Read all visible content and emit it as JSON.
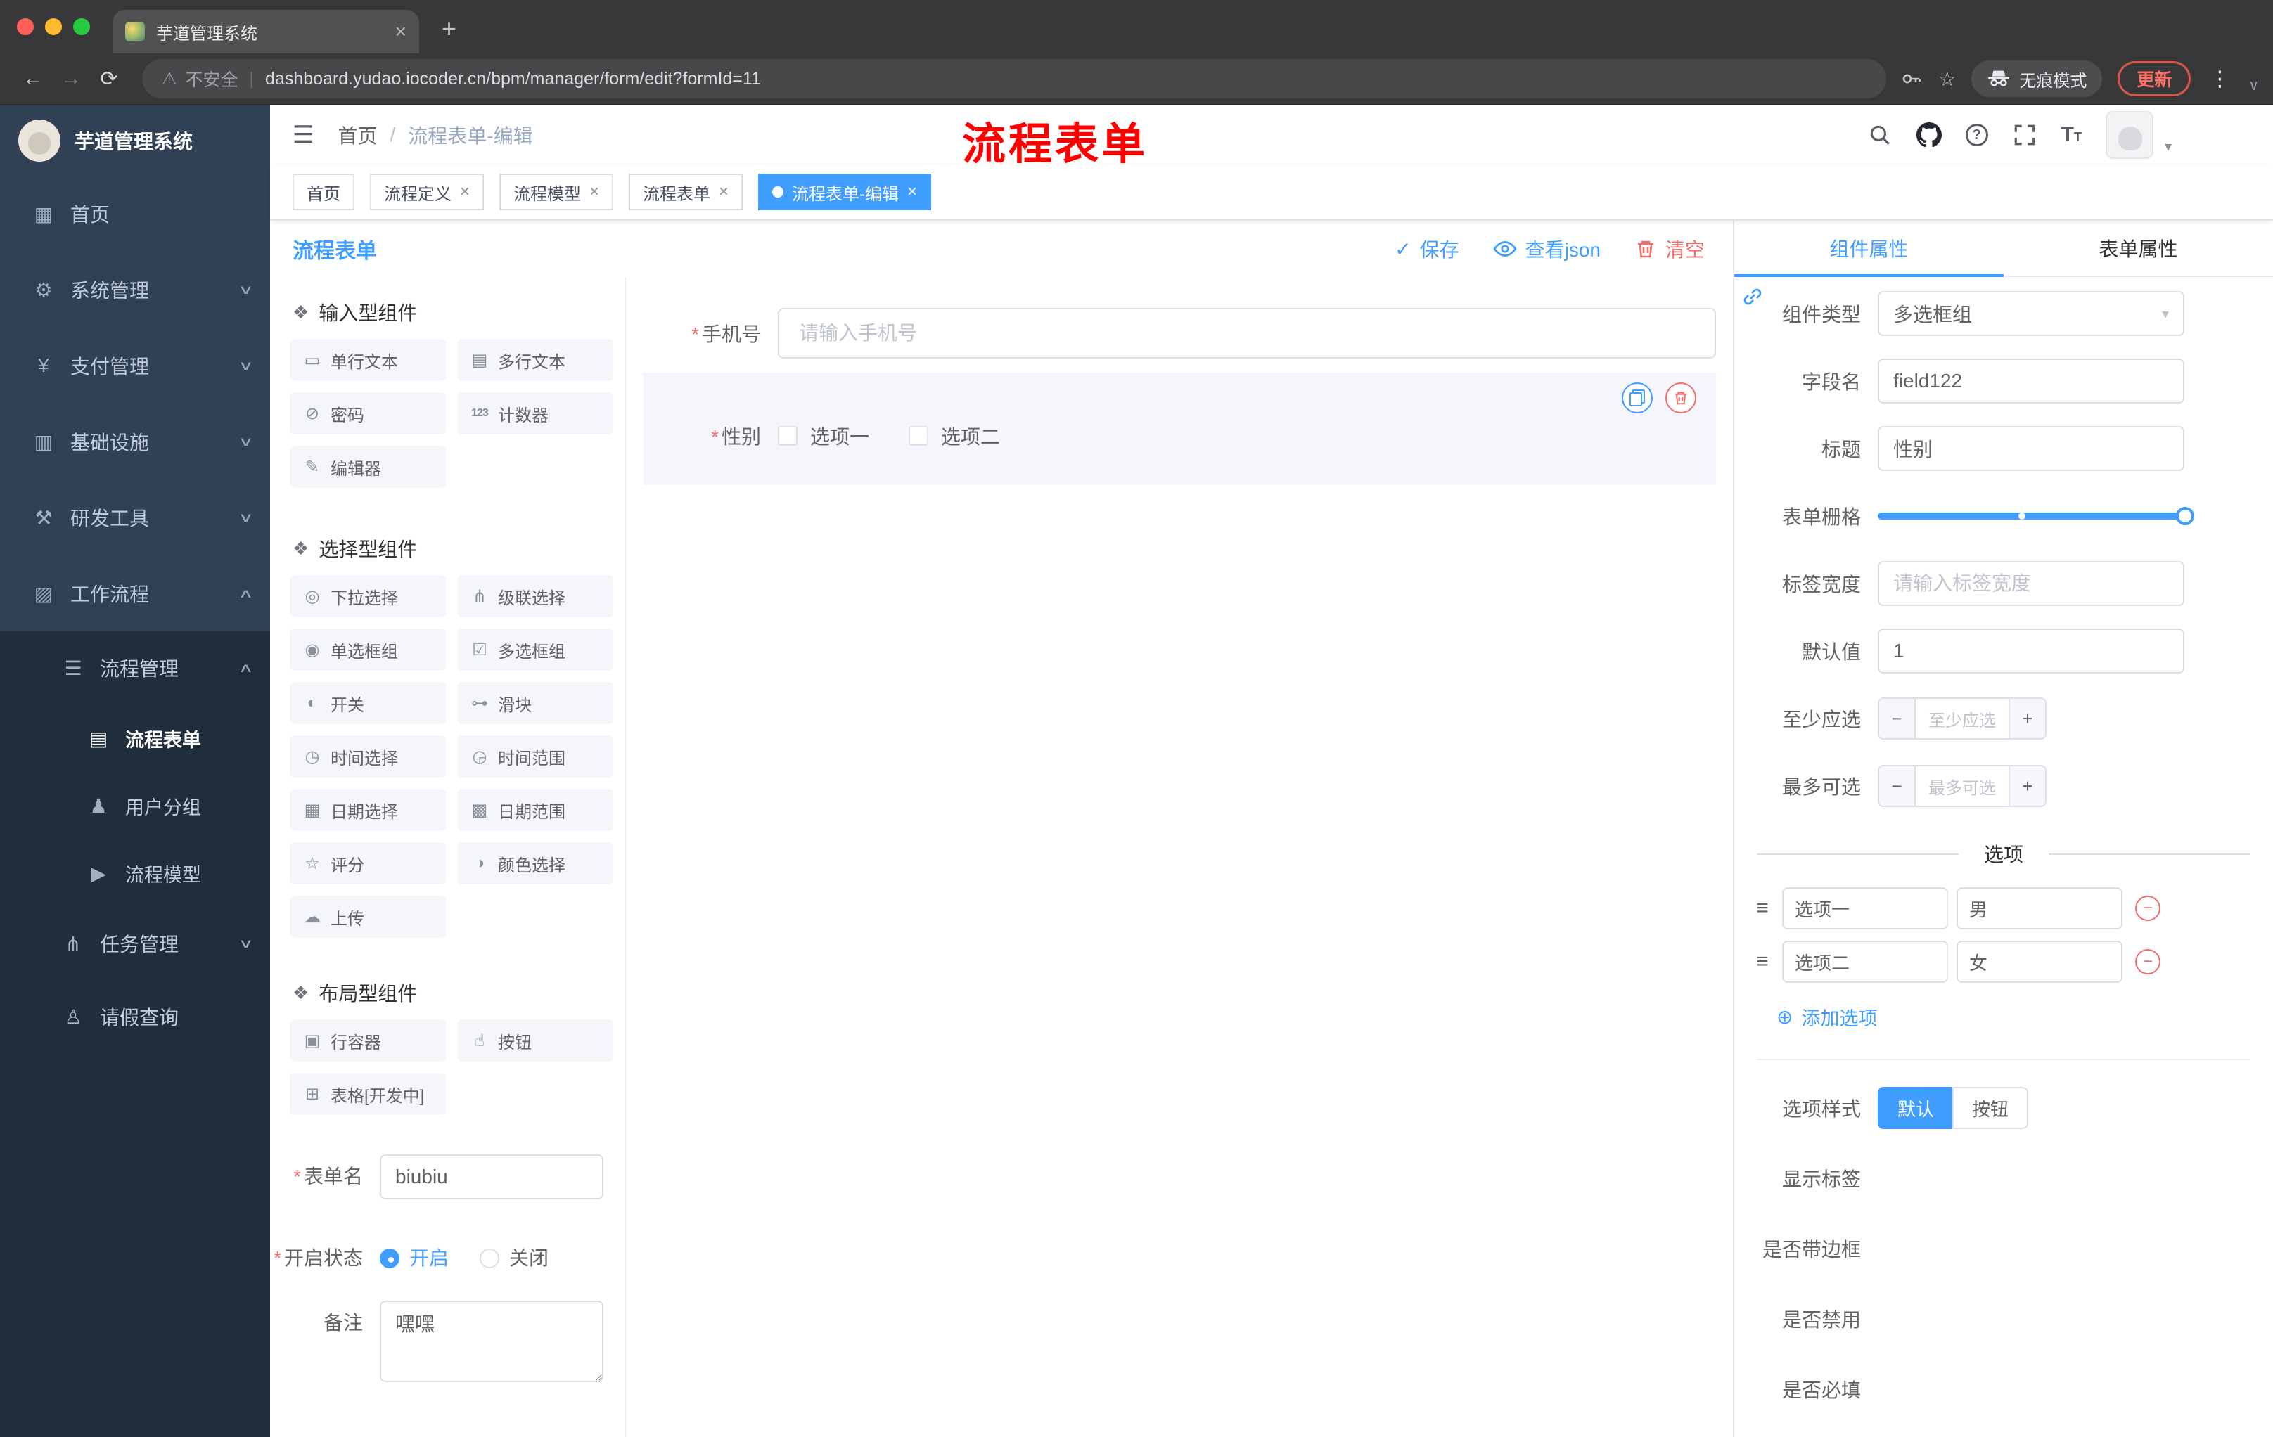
{
  "ui": {
    "close": "×",
    "plus": "+",
    "back": "←",
    "forward": "→",
    "reload": "⟳",
    "warning": "⚠",
    "divider": "|",
    "star": "☆",
    "kebab": "⋮",
    "caret": "▾",
    "chev_down": "∨",
    "chev_up": "∧",
    "hamburger": "☰",
    "breadcrumb_sep": "/",
    "required": "*",
    "check": "✓",
    "minus": "−",
    "add": "⊕",
    "drag": "≡",
    "help": "?",
    "font_big": "T",
    "font_small": "T",
    "select_caret": "▼"
  },
  "browser": {
    "tab_title": "芋道管理系统",
    "security_label": "不安全",
    "url": "dashboard.yudao.iocoder.cn/bpm/manager/form/edit?formId=11",
    "incognito_label": "无痕模式",
    "update_label": "更新"
  },
  "annotation": {
    "text": "流程表单"
  },
  "sidebar": {
    "title": "芋道管理系统",
    "items": [
      {
        "icon": "▦",
        "label": "首页"
      },
      {
        "icon": "⚙",
        "label": "系统管理"
      },
      {
        "icon": "¥",
        "label": "支付管理"
      },
      {
        "icon": "▥",
        "label": "基础设施"
      },
      {
        "icon": "⚒",
        "label": "研发工具"
      },
      {
        "icon": "▨",
        "label": "工作流程"
      },
      {
        "icon": "☰",
        "label": "流程管理"
      },
      {
        "icon": "▤",
        "label": "流程表单"
      },
      {
        "icon": "♟",
        "label": "用户分组"
      },
      {
        "icon": "▶",
        "label": "流程模型"
      },
      {
        "icon": "⋔",
        "label": "任务管理"
      },
      {
        "icon": "♙",
        "label": "请假查询"
      }
    ]
  },
  "header": {
    "breadcrumb": {
      "home": "首页",
      "current": "流程表单-编辑"
    }
  },
  "tags": [
    {
      "label": "首页"
    },
    {
      "label": "流程定义"
    },
    {
      "label": "流程模型"
    },
    {
      "label": "流程表单"
    },
    {
      "label": "流程表单-编辑"
    }
  ],
  "page": {
    "title": "流程表单",
    "save": "保存",
    "view_json": "查看json",
    "clear": "清空"
  },
  "palette": {
    "sections": [
      {
        "title": "输入型组件",
        "items": [
          {
            "icon": "▭",
            "label": "单行文本"
          },
          {
            "icon": "▤",
            "label": "多行文本"
          },
          {
            "icon": "⊘",
            "label": "密码"
          },
          {
            "icon": "123",
            "label": "计数器"
          },
          {
            "icon": "✎",
            "label": "编辑器"
          }
        ]
      },
      {
        "title": "选择型组件",
        "items": [
          {
            "icon": "◎",
            "label": "下拉选择"
          },
          {
            "icon": "⋔",
            "label": "级联选择"
          },
          {
            "icon": "◉",
            "label": "单选框组"
          },
          {
            "icon": "☑",
            "label": "多选框组"
          },
          {
            "icon": "◐",
            "label": "开关"
          },
          {
            "icon": "⊶",
            "label": "滑块"
          },
          {
            "icon": "◷",
            "label": "时间选择"
          },
          {
            "icon": "◶",
            "label": "时间范围"
          },
          {
            "icon": "▦",
            "label": "日期选择"
          },
          {
            "icon": "▩",
            "label": "日期范围"
          },
          {
            "icon": "☆",
            "label": "评分"
          },
          {
            "icon": "◑",
            "label": "颜色选择"
          },
          {
            "icon": "☁",
            "label": "上传"
          }
        ]
      },
      {
        "title": "布局型组件",
        "items": [
          {
            "icon": "▣",
            "label": "行容器"
          },
          {
            "icon": "☝",
            "label": "按钮"
          },
          {
            "icon": "⊞",
            "label": "表格[开发中]"
          }
        ]
      }
    ],
    "form": {
      "name_label": "表单名",
      "name_value": "biubiu",
      "status_label": "开启状态",
      "status_on": "开启",
      "status_off": "关闭",
      "remark_label": "备注",
      "remark_value": "嘿嘿"
    }
  },
  "canvas": {
    "phone": {
      "label": "手机号",
      "placeholder": "请输入手机号"
    },
    "gender": {
      "label": "性别",
      "option1": "选项一",
      "option2": "选项二"
    }
  },
  "inspector": {
    "tab_component": "组件属性",
    "tab_form": "表单属性",
    "component_type": {
      "label": "组件类型",
      "value": "多选框组"
    },
    "field_name": {
      "label": "字段名",
      "value": "field122"
    },
    "title_field": {
      "label": "标题",
      "value": "性别"
    },
    "grid": {
      "label": "表单栅格"
    },
    "label_width": {
      "label": "标签宽度",
      "placeholder": "请输入标签宽度"
    },
    "default_value": {
      "label": "默认值",
      "value": "1"
    },
    "min_select": {
      "label": "至少应选",
      "placeholder": "至少应选"
    },
    "max_select": {
      "label": "最多可选",
      "placeholder": "最多可选"
    },
    "options_title": "选项",
    "options": [
      {
        "name": "选项一",
        "value": "男"
      },
      {
        "name": "选项二",
        "value": "女"
      }
    ],
    "add_option": "添加选项",
    "option_style": {
      "label": "选项样式",
      "default": "默认",
      "button": "按钮"
    },
    "switches": [
      {
        "label": "显示标签",
        "on": true
      },
      {
        "label": "是否带边框",
        "on": false
      },
      {
        "label": "是否禁用",
        "on": false
      },
      {
        "label": "是否必填",
        "on": true
      }
    ]
  },
  "colors": {
    "primary": "#409eff",
    "danger": "#f56c6c",
    "annotation": "#fe0000"
  }
}
